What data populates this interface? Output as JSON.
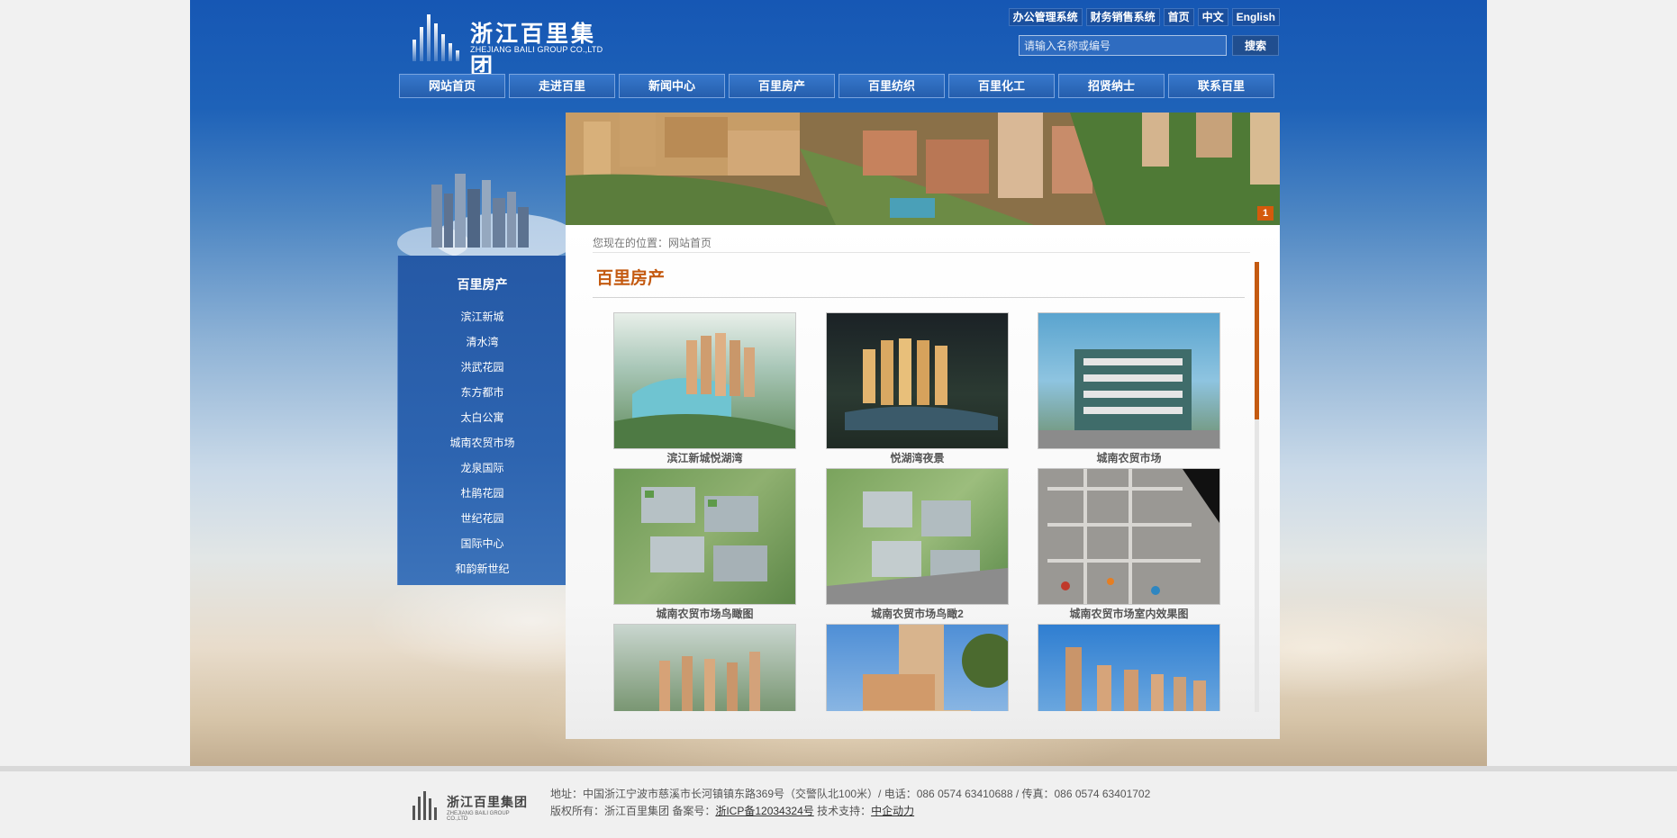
{
  "logo": {
    "cn": "浙江百里集团",
    "en": "ZHEJIANG BAILI GROUP CO.,LTD"
  },
  "top_links": [
    "办公管理系统",
    "财务销售系统",
    "首页",
    "中文",
    "English"
  ],
  "search": {
    "placeholder": "请输入名称或编号",
    "button": "搜索"
  },
  "nav": [
    "网站首页",
    "走进百里",
    "新闻中心",
    "百里房产",
    "百里纺织",
    "百里化工",
    "招贤纳士",
    "联系百里"
  ],
  "banner": {
    "slide_number": "1"
  },
  "sidebar": {
    "title": "百里房产",
    "items": [
      "滨江新城",
      "清水湾",
      "洪武花园",
      "东方都市",
      "太白公寓",
      "城南农贸市场",
      "龙泉国际",
      "杜鹃花园",
      "世纪花园",
      "国际中心",
      "和韵新世纪"
    ]
  },
  "content": {
    "breadcrumb": "您现在的位置：网站首页",
    "title": "百里房产",
    "gallery": [
      {
        "caption": "滨江新城悦湖湾"
      },
      {
        "caption": "悦湖湾夜景"
      },
      {
        "caption": "城南农贸市场"
      },
      {
        "caption": "城南农贸市场鸟瞰图"
      },
      {
        "caption": "城南农贸市场鸟瞰2"
      },
      {
        "caption": "城南农贸市场室内效果图"
      },
      {
        "caption": ""
      },
      {
        "caption": ""
      },
      {
        "caption": ""
      }
    ]
  },
  "footer": {
    "logo_cn": "浙江百里集团",
    "logo_en": "ZHEJIANG BAILI GROUP CO.,LTD",
    "address": "地址：中国浙江宁波市慈溪市长河镇镇东路369号（交警队北100米）/ 电话：086 0574 63410688 / 传真：086 0574 63401702",
    "copyright_prefix": "版权所有：浙江百里集团 备案号：",
    "icp": "浙ICP备12034324号",
    "tech_prefix": " 技术支持：",
    "tech_link": "中企动力"
  }
}
